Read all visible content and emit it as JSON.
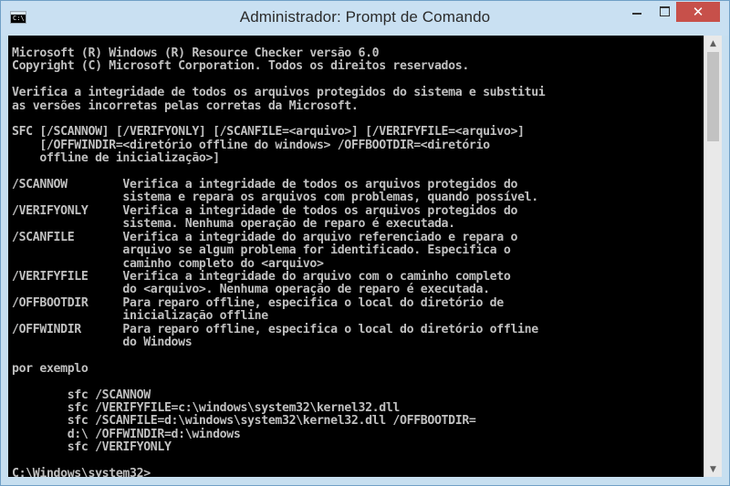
{
  "window": {
    "title": "Administrador: Prompt de Comando",
    "close_glyph": "✕"
  },
  "console": {
    "lines": [
      "Microsoft (R) Windows (R) Resource Checker versão 6.0",
      "Copyright (C) Microsoft Corporation. Todos os direitos reservados.",
      "",
      "Verifica a integridade de todos os arquivos protegidos do sistema e substitui",
      "as versões incorretas pelas corretas da Microsoft.",
      "",
      "SFC [/SCANNOW] [/VERIFYONLY] [/SCANFILE=<arquivo>] [/VERIFYFILE=<arquivo>]",
      "    [/OFFWINDIR=<diretório offline do windows> /OFFBOOTDIR=<diretório",
      "    offline de inicialização>]",
      "",
      "/SCANNOW        Verifica a integridade de todos os arquivos protegidos do",
      "                sistema e repara os arquivos com problemas, quando possível.",
      "/VERIFYONLY     Verifica a integridade de todos os arquivos protegidos do",
      "                sistema. Nenhuma operação de reparo é executada.",
      "/SCANFILE       Verifica a integridade do arquivo referenciado e repara o",
      "                arquivo se algum problema for identificado. Especifica o",
      "                caminho completo do <arquivo>",
      "/VERIFYFILE     Verifica a integridade do arquivo com o caminho completo",
      "                do <arquivo>. Nenhuma operação de reparo é executada.",
      "/OFFBOOTDIR     Para reparo offline, especifica o local do diretório de",
      "                inicialização offline",
      "/OFFWINDIR      Para reparo offline, especifica o local do diretório offline",
      "                do Windows",
      "",
      "por exemplo",
      "",
      "        sfc /SCANNOW",
      "        sfc /VERIFYFILE=c:\\windows\\system32\\kernel32.dll",
      "        sfc /SCANFILE=d:\\windows\\system32\\kernel32.dll /OFFBOOTDIR=",
      "        d:\\ /OFFWINDIR=d:\\windows",
      "        sfc /VERIFYONLY",
      "",
      "C:\\Windows\\system32>"
    ]
  },
  "scrollbar": {
    "up_glyph": "▲",
    "down_glyph": "▼",
    "position_fraction": 0.0
  },
  "colors": {
    "console_background": "#000000",
    "console_text": "#c0c0c0",
    "titlebar": "#c9e0f2",
    "close_button": "#c7504a"
  }
}
